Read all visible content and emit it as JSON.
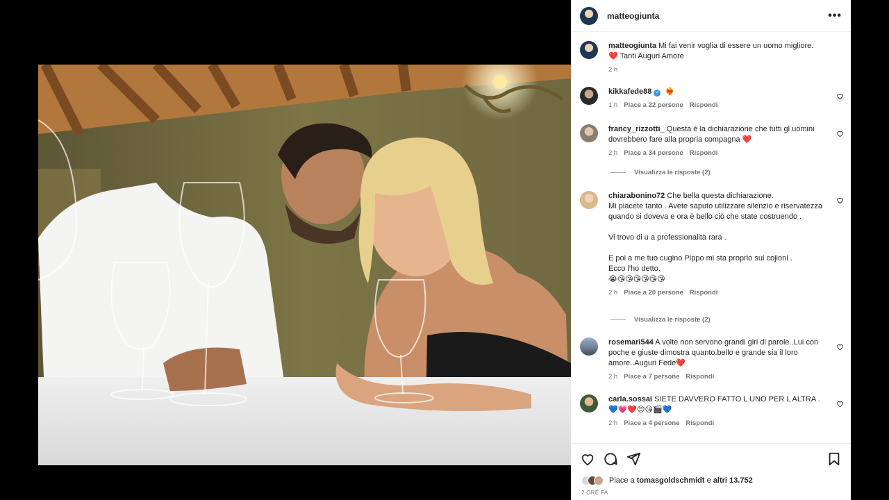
{
  "post": {
    "author": "matteogiunta",
    "caption_user": "matteogiunta",
    "caption_text": "Mi fai venir voglia di essere un uomo migliore.",
    "caption_line2": "Tanti Auguri Amore",
    "caption_time": "2 h"
  },
  "comments": [
    {
      "user": "kikkafede88",
      "verified": true,
      "text": "",
      "emoji": "❤️‍🔥",
      "time": "1 h",
      "likes": "Piace a 22 persone",
      "reply": "Rispondi"
    },
    {
      "user": "francy_rizzotti_",
      "text": "Questa è la dichiarazione che tutti gl uomini dovrebbero fare alla propria compagna ❤️",
      "time": "2 h",
      "likes": "Piace a 34 persone",
      "reply": "Rispondi",
      "view_replies": "Visualizza le risposte (2)"
    },
    {
      "user": "chiarabonino72",
      "text": "Che bella questa dichiarazione.",
      "lines": [
        "Mi piacete tanto . Avete saputo utilizzare silenzio e riservatezza quando si doveva e ora è bello ciò che state costruendo .",
        "Vi trovo di u a professionalità rara .",
        "E poi a me tuo cugino Pippo mi sta proprio sui cojioni .",
        "Ecco l'ho detto.",
        "😭😘😘😘😘😘😘"
      ],
      "time": "2 h",
      "likes": "Piace a 20 persone",
      "reply": "Rispondi",
      "view_replies": "Visualizza le risposte (2)"
    },
    {
      "user": "rosemari544",
      "text": "A volte non servono grandi giri di parole..Lui con poche e giuste dimostra quanto.bello e grande sia il loro amore..Auguri Fede❤️",
      "time": "2 h",
      "likes": "Piace a 7 persone",
      "reply": "Rispondi"
    },
    {
      "user": "carla.sossai",
      "text": "SIETE DAVVERO FATTO L UNO PER L ALTRA .",
      "line2": "💙💗❤️😍😘🎬💙",
      "time": "2 h",
      "likes": "Piace a 4 persone",
      "reply": "Rispondi"
    }
  ],
  "footer": {
    "likes_prefix": "Piace a",
    "likes_user": "tomasgoldschmidt",
    "likes_mid": "e",
    "likes_count": "altri 13.752",
    "date": "2 ORE FA"
  },
  "icons": {
    "heart": "heart-icon",
    "comment": "comment-icon",
    "share": "share-icon",
    "save": "bookmark-icon",
    "more": "more-icon"
  },
  "colors": {
    "heart_red": "#ed4956",
    "verified_blue": "#3897f0",
    "meta_gray": "#737373"
  }
}
